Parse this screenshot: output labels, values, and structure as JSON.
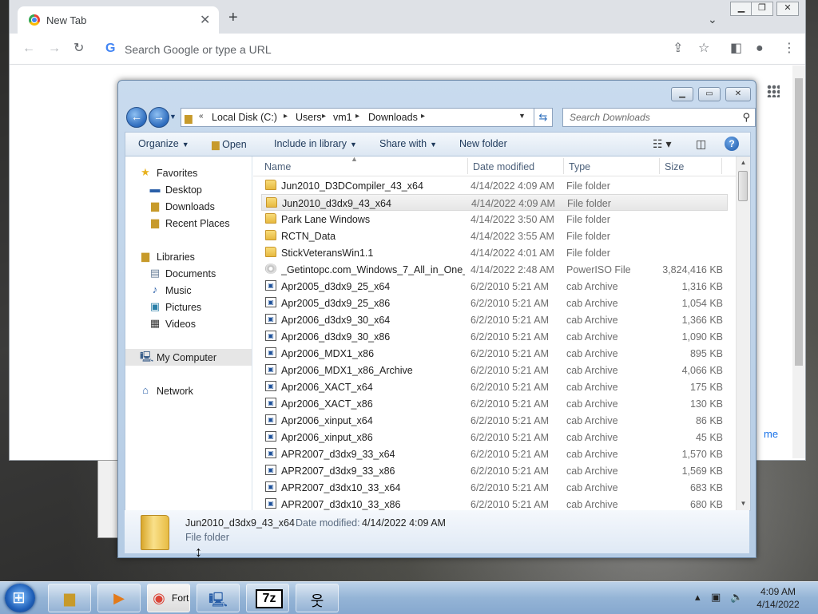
{
  "chrome": {
    "tab_title": "New Tab",
    "omnibox_placeholder": "Search Google or type a URL",
    "partial_text": "me"
  },
  "explorer": {
    "breadcrumb": [
      "Local Disk (C:)",
      "Users",
      "vm1",
      "Downloads"
    ],
    "search_placeholder": "Search Downloads",
    "toolbar": {
      "organize": "Organize",
      "open": "Open",
      "include": "Include in library",
      "share": "Share with",
      "new_folder": "New folder"
    },
    "nav": {
      "favorites": "Favorites",
      "desktop": "Desktop",
      "downloads": "Downloads",
      "recent": "Recent Places",
      "libraries": "Libraries",
      "documents": "Documents",
      "music": "Music",
      "pictures": "Pictures",
      "videos": "Videos",
      "computer": "My Computer",
      "network": "Network"
    },
    "columns": {
      "name": "Name",
      "date": "Date modified",
      "type": "Type",
      "size": "Size"
    },
    "rows": [
      {
        "name": "Jun2010_D3DCompiler_43_x64",
        "date": "4/14/2022 4:09 AM",
        "type": "File folder",
        "size": "",
        "icon": "folder"
      },
      {
        "name": "Jun2010_d3dx9_43_x64",
        "date": "4/14/2022 4:09 AM",
        "type": "File folder",
        "size": "",
        "icon": "folder"
      },
      {
        "name": "Park Lane Windows",
        "date": "4/14/2022 3:50 AM",
        "type": "File folder",
        "size": "",
        "icon": "folder"
      },
      {
        "name": "RCTN_Data",
        "date": "4/14/2022 3:55 AM",
        "type": "File folder",
        "size": "",
        "icon": "folder"
      },
      {
        "name": "StickVeteransWin1.1",
        "date": "4/14/2022 4:01 AM",
        "type": "File folder",
        "size": "",
        "icon": "folder"
      },
      {
        "name": "_Getintopc.com_Windows_7_All_in_One_...",
        "date": "4/14/2022 2:48 AM",
        "type": "PowerISO File",
        "size": "3,824,416 KB",
        "icon": "disc"
      },
      {
        "name": "Apr2005_d3dx9_25_x64",
        "date": "6/2/2010 5:21 AM",
        "type": "cab Archive",
        "size": "1,316 KB",
        "icon": "cab"
      },
      {
        "name": "Apr2005_d3dx9_25_x86",
        "date": "6/2/2010 5:21 AM",
        "type": "cab Archive",
        "size": "1,054 KB",
        "icon": "cab"
      },
      {
        "name": "Apr2006_d3dx9_30_x64",
        "date": "6/2/2010 5:21 AM",
        "type": "cab Archive",
        "size": "1,366 KB",
        "icon": "cab"
      },
      {
        "name": "Apr2006_d3dx9_30_x86",
        "date": "6/2/2010 5:21 AM",
        "type": "cab Archive",
        "size": "1,090 KB",
        "icon": "cab"
      },
      {
        "name": "Apr2006_MDX1_x86",
        "date": "6/2/2010 5:21 AM",
        "type": "cab Archive",
        "size": "895 KB",
        "icon": "cab"
      },
      {
        "name": "Apr2006_MDX1_x86_Archive",
        "date": "6/2/2010 5:21 AM",
        "type": "cab Archive",
        "size": "4,066 KB",
        "icon": "cab"
      },
      {
        "name": "Apr2006_XACT_x64",
        "date": "6/2/2010 5:21 AM",
        "type": "cab Archive",
        "size": "175 KB",
        "icon": "cab"
      },
      {
        "name": "Apr2006_XACT_x86",
        "date": "6/2/2010 5:21 AM",
        "type": "cab Archive",
        "size": "130 KB",
        "icon": "cab"
      },
      {
        "name": "Apr2006_xinput_x64",
        "date": "6/2/2010 5:21 AM",
        "type": "cab Archive",
        "size": "86 KB",
        "icon": "cab"
      },
      {
        "name": "Apr2006_xinput_x86",
        "date": "6/2/2010 5:21 AM",
        "type": "cab Archive",
        "size": "45 KB",
        "icon": "cab"
      },
      {
        "name": "APR2007_d3dx9_33_x64",
        "date": "6/2/2010 5:21 AM",
        "type": "cab Archive",
        "size": "1,570 KB",
        "icon": "cab"
      },
      {
        "name": "APR2007_d3dx9_33_x86",
        "date": "6/2/2010 5:21 AM",
        "type": "cab Archive",
        "size": "1,569 KB",
        "icon": "cab"
      },
      {
        "name": "APR2007_d3dx10_33_x64",
        "date": "6/2/2010 5:21 AM",
        "type": "cab Archive",
        "size": "683 KB",
        "icon": "cab"
      },
      {
        "name": "APR2007_d3dx10_33_x86",
        "date": "6/2/2010 5:21 AM",
        "type": "cab Archive",
        "size": "680 KB",
        "icon": "cab"
      }
    ],
    "selected_index": 1,
    "details": {
      "name": "Jun2010_d3dx9_43_x64",
      "date_label": "Date modified:",
      "date_value": "4/14/2022 4:09 AM",
      "type": "File folder"
    }
  },
  "taskbar": {
    "chrome_label": "Fort",
    "sevenzip_label": "7z",
    "time": "4:09 AM",
    "date": "4/14/2022"
  },
  "colors": {
    "accent": "#1a73e8",
    "explorer_frame": "#b4cbe4",
    "taskbar": "#94b4d6"
  }
}
